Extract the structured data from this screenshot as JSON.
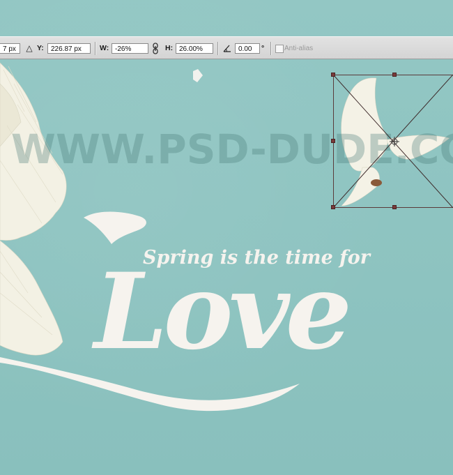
{
  "options_bar": {
    "x_value": "7 px",
    "reference_point_icon": "triangle-delta-icon",
    "y_label": "Y:",
    "y_value": "226.87 px",
    "w_label": "W:",
    "w_value": "-26%",
    "link_icon": "link-chain-icon",
    "h_label": "H:",
    "h_value": "26.00%",
    "angle_icon": "angle-icon",
    "angle_value": "0.00",
    "angle_unit": "°",
    "anti_alias_label": "Anti-alias"
  },
  "canvas": {
    "background_color": "#8ec4c1",
    "watermark": "WWW.PSD-DUDE.COM",
    "tagline": "Spring is the time for",
    "headline": "Love",
    "text_color": "#f6f3ee"
  },
  "transform": {
    "handle_color": "#7a3a3a"
  }
}
